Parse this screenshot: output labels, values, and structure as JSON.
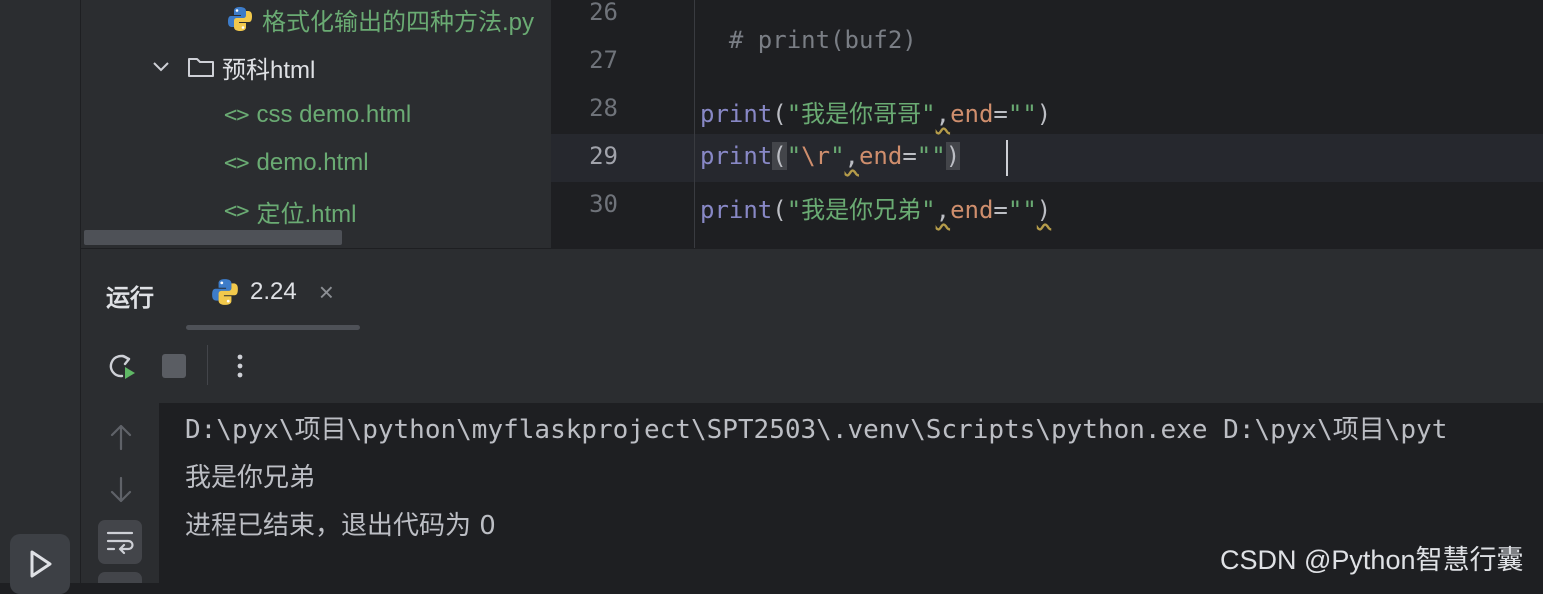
{
  "project_tree": {
    "items": [
      {
        "label": "格式化输出的四种方法.py",
        "kind": "python-file"
      },
      {
        "label": "预科html",
        "kind": "folder",
        "expanded": true
      },
      {
        "label": "css demo.html",
        "kind": "html-file"
      },
      {
        "label": "demo.html",
        "kind": "html-file"
      },
      {
        "label": "定位.html",
        "kind": "html-file"
      }
    ]
  },
  "editor": {
    "line_numbers": [
      "26",
      "27",
      "28",
      "29",
      "30"
    ],
    "current_line": "29",
    "lines": {
      "l26": "# print(buf2)",
      "l28_fn": "print",
      "l28_open": "(",
      "l28_str": "\"我是你哥哥\"",
      "l28_comma": ",",
      "l28_param": "end",
      "l28_eq": "=",
      "l28_str2": "\"\"",
      "l28_close": ")",
      "l29_fn": "print",
      "l29_open": "(",
      "l29_q1": "\"",
      "l29_esc": "\\r",
      "l29_q2": "\"",
      "l29_comma": ",",
      "l29_param": "end",
      "l29_eq": "=",
      "l29_str2": "\"\"",
      "l29_close": ")",
      "l30_fn": "print",
      "l30_open": "(",
      "l30_str": "\"我是你兄弟\"",
      "l30_comma": ",",
      "l30_param": "end",
      "l30_eq": "=",
      "l30_str2": "\"\"",
      "l30_close": ")"
    }
  },
  "run_panel": {
    "title": "运行",
    "tab_label": "2.24",
    "tab_close": "×"
  },
  "console": {
    "lines": [
      "D:\\pyx\\项目\\python\\myflaskproject\\SPT2503\\.venv\\Scripts\\python.exe D:\\pyx\\项目\\pyt",
      "我是你兄弟",
      "进程已结束，退出代码为 0"
    ]
  },
  "watermark": "CSDN @Python智慧行囊",
  "colors": {
    "accent_green": "#6aab73",
    "param_orange": "#cf8e6d",
    "builtin_purple": "#8888c6"
  }
}
